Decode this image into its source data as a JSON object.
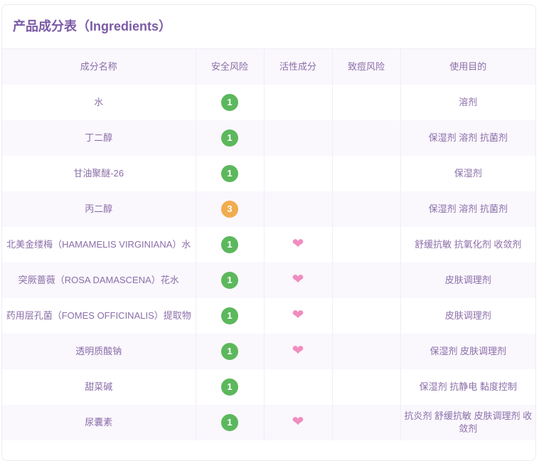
{
  "title": "产品成分表（Ingredients）",
  "headers": [
    "成分名称",
    "安全风险",
    "活性成分",
    "致痘风险",
    "使用目的"
  ],
  "colors": {
    "risk_low": "#5cb85c",
    "risk_mid": "#f0ad4e",
    "heart": "#f08dc0"
  },
  "rows": [
    {
      "name": "水",
      "risk": "1",
      "active": false,
      "acne": "",
      "purpose": "溶剂"
    },
    {
      "name": "丁二醇",
      "risk": "1",
      "active": false,
      "acne": "",
      "purpose": "保湿剂 溶剂 抗菌剂"
    },
    {
      "name": "甘油聚醚-26",
      "risk": "1",
      "active": false,
      "acne": "",
      "purpose": "保湿剂"
    },
    {
      "name": "丙二醇",
      "risk": "3",
      "active": false,
      "acne": "",
      "purpose": "保湿剂 溶剂 抗菌剂"
    },
    {
      "name": "北美金缕梅（HAMAMELIS VIRGINIANA）水",
      "risk": "1",
      "active": true,
      "acne": "",
      "purpose": "舒缓抗敏 抗氧化剂 收敛剂"
    },
    {
      "name": "突厥蔷薇（ROSA DAMASCENA）花水",
      "risk": "1",
      "active": true,
      "acne": "",
      "purpose": "皮肤调理剂"
    },
    {
      "name": "药用层孔菌（FOMES OFFICINALIS）提取物",
      "risk": "1",
      "active": true,
      "acne": "",
      "purpose": "皮肤调理剂"
    },
    {
      "name": "透明质酸钠",
      "risk": "1",
      "active": true,
      "acne": "",
      "purpose": "保湿剂 皮肤调理剂"
    },
    {
      "name": "甜菜碱",
      "risk": "1",
      "active": false,
      "acne": "",
      "purpose": "保湿剂 抗静电 黏度控制"
    },
    {
      "name": "尿囊素",
      "risk": "1",
      "active": true,
      "acne": "",
      "purpose": "抗炎剂 舒缓抗敏 皮肤调理剂 收敛剂"
    }
  ]
}
